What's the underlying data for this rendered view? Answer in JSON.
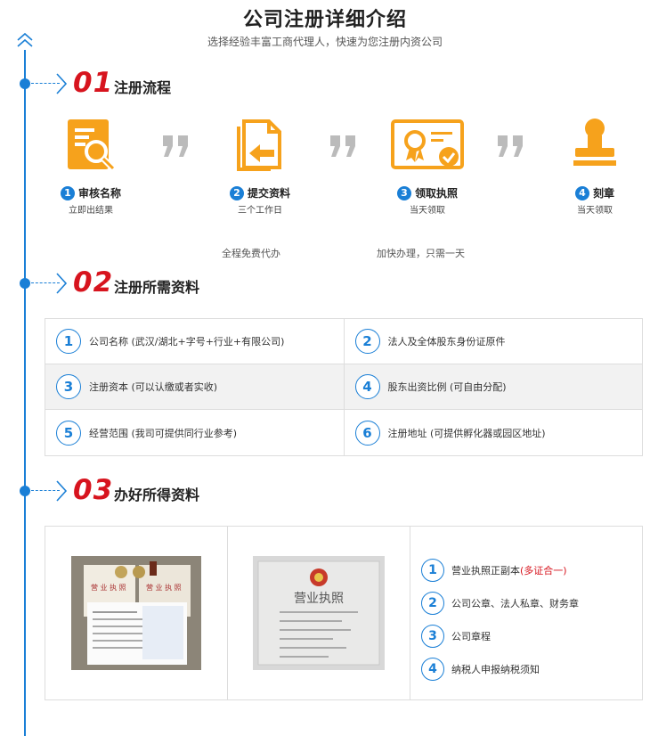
{
  "header": {
    "title": "公司注册详细介绍",
    "subtitle": "选择经验丰富工商代理人，快速为您注册内资公司"
  },
  "colors": {
    "accent": "#1a7fd6",
    "number_red": "#d7141e",
    "icon_orange": "#f6a21c",
    "quote_gray": "#bbbbbb"
  },
  "sections": [
    {
      "num": "01",
      "label": "注册流程"
    },
    {
      "num": "02",
      "label": "注册所需资料"
    },
    {
      "num": "03",
      "label": "办好所得资料"
    }
  ],
  "steps": [
    {
      "n": "1",
      "title": "审核名称",
      "sub": "立即出结果",
      "icon": "document-search-icon"
    },
    {
      "n": "2",
      "title": "提交资料",
      "sub": "三个工作日",
      "icon": "document-submit-icon"
    },
    {
      "n": "3",
      "title": "领取执照",
      "sub": "当天领取",
      "icon": "certificate-icon"
    },
    {
      "n": "4",
      "title": "刻章",
      "sub": "当天领取",
      "icon": "stamp-icon"
    }
  ],
  "notes": [
    "全程免费代办",
    "加快办理，只需一天"
  ],
  "requirements": [
    {
      "n": "1",
      "text": "公司名称 (武汉/湖北+字号+行业+有限公司)"
    },
    {
      "n": "2",
      "text": "法人及全体股东身份证原件"
    },
    {
      "n": "3",
      "text": "注册资本 (可以认缴或者实收)"
    },
    {
      "n": "4",
      "text": "股东出资比例 (可自由分配)"
    },
    {
      "n": "5",
      "text": "经营范围 (我司可提供同行业参考)"
    },
    {
      "n": "6",
      "text": "注册地址 (可提供孵化器或园区地址)"
    }
  ],
  "photo1": {
    "license_text": "营 业 执 照"
  },
  "photo2": {
    "license_text": "营业执照"
  },
  "results": [
    {
      "n": "1",
      "text": "营业执照正副本",
      "extra": "(多证合一)"
    },
    {
      "n": "2",
      "text": "公司公章、法人私章、财务章",
      "extra": ""
    },
    {
      "n": "3",
      "text": "公司章程",
      "extra": ""
    },
    {
      "n": "4",
      "text": "纳税人申报纳税须知",
      "extra": ""
    }
  ]
}
